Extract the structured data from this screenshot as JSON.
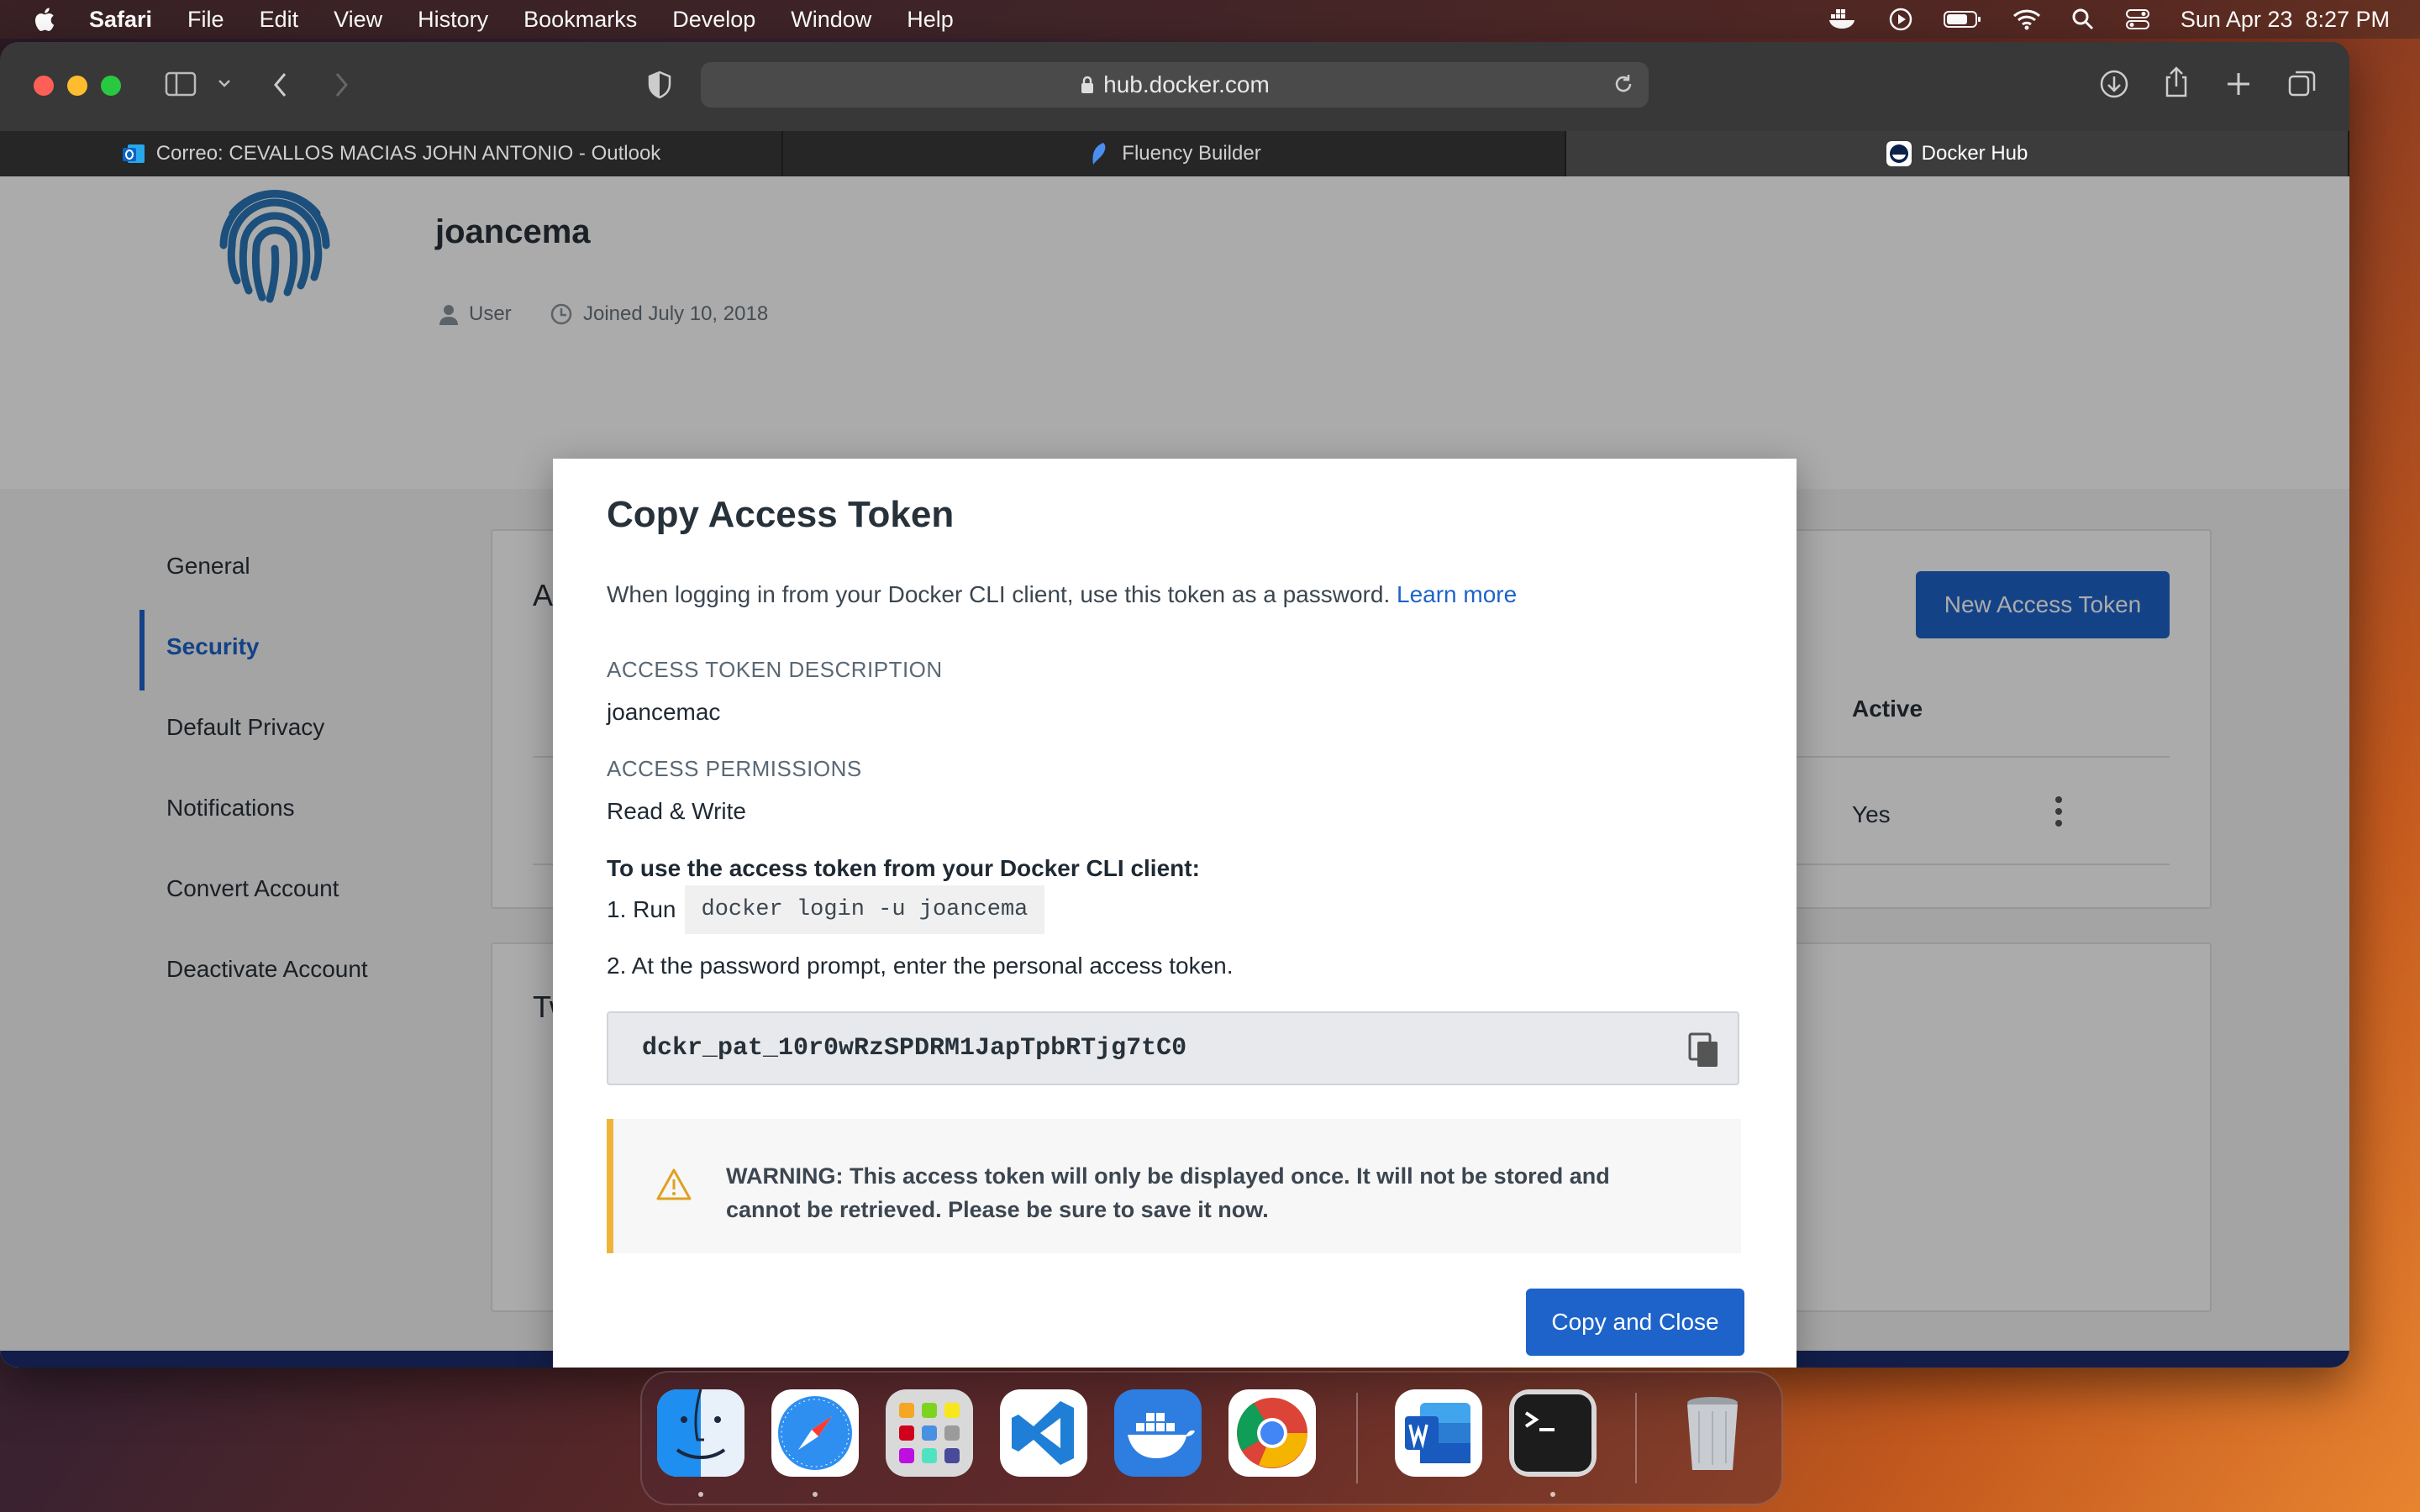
{
  "menubar": {
    "app_name": "Safari",
    "items": [
      "File",
      "Edit",
      "View",
      "History",
      "Bookmarks",
      "Develop",
      "Window",
      "Help"
    ],
    "datetime": "Sun Apr 23  8:27 PM"
  },
  "browser": {
    "url": "hub.docker.com",
    "tabs": [
      {
        "label": "Correo: CEVALLOS MACIAS JOHN ANTONIO - Outlook",
        "icon": "outlook-icon",
        "active": false
      },
      {
        "label": "Fluency Builder",
        "icon": "fluency-builder-icon",
        "active": false
      },
      {
        "label": "Docker Hub",
        "icon": "docker-hub-icon",
        "active": true
      }
    ]
  },
  "profile": {
    "username": "joancema",
    "role": "User",
    "joined": "Joined July 10, 2018"
  },
  "sidebar": {
    "items": [
      {
        "label": "General"
      },
      {
        "label": "Security",
        "active": true
      },
      {
        "label": "Default Privacy"
      },
      {
        "label": "Notifications"
      },
      {
        "label": "Convert Account"
      },
      {
        "label": "Deactivate Account"
      }
    ]
  },
  "background_page": {
    "card1_title_partial": "A",
    "card2_title_partial": "Tw",
    "new_token_button": "New Access Token",
    "active_header": "Active",
    "active_value": "Yes"
  },
  "modal": {
    "title": "Copy Access Token",
    "intro": "When logging in from your Docker CLI client, use this token as a password.",
    "learn_more": "Learn more",
    "description_label": "ACCESS TOKEN DESCRIPTION",
    "description_value": "joancemac",
    "permissions_label": "ACCESS PERMISSIONS",
    "permissions_value": "Read & Write",
    "howto_title": "To use the access token from your Docker CLI client:",
    "step1_prefix": "1. Run",
    "step1_command": "docker login -u joancema",
    "step2": "2. At the password prompt, enter the personal access token.",
    "token": "dckr_pat_10r0wRzSPDRM1JapTpbRTjg7tC0",
    "warning": "WARNING: This access token will only be displayed once. It will not be stored and cannot be retrieved. Please be sure to save it now.",
    "copy_close_button": "Copy and Close"
  },
  "colors": {
    "accent": "#1d63c9",
    "warning": "#f0b33a",
    "footer": "#1c2d6e"
  },
  "dock": {
    "apps": [
      "Finder",
      "Safari",
      "Launchpad",
      "Visual Studio Code",
      "Docker",
      "Google Chrome",
      "Microsoft Word",
      "Terminal",
      "Trash"
    ]
  }
}
